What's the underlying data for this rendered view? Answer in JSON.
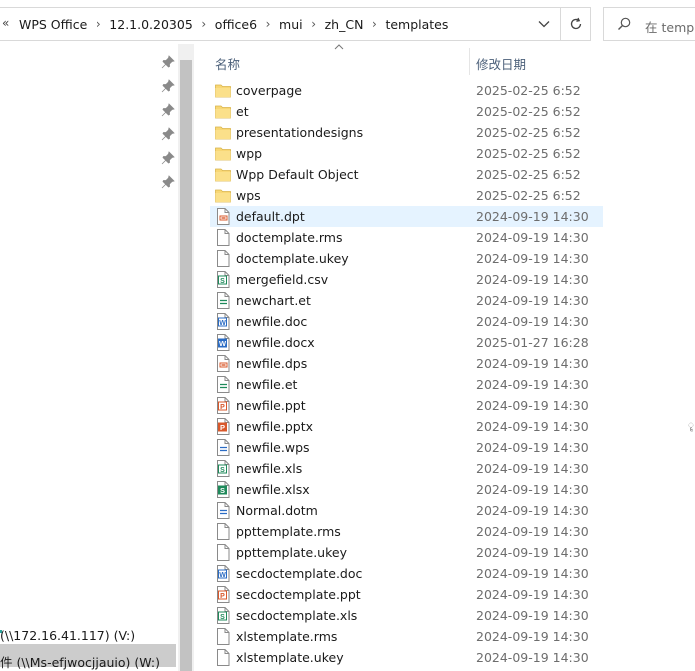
{
  "breadcrumb": {
    "overflow": "«",
    "items": [
      "WPS Office",
      "12.1.0.20305",
      "office6",
      "mui",
      "zh_CN",
      "templates"
    ]
  },
  "search": {
    "placeholder": "在 templa"
  },
  "columns": {
    "name": "名称",
    "date_modified": "修改日期"
  },
  "nav": {
    "drives": [
      "(\\\\172.16.41.117) (V:)",
      "件 (\\\\Ms-efjwocjjauio) (W:)"
    ]
  },
  "files": [
    {
      "name": "coverpage",
      "date": "2025-02-25 6:52",
      "icon": "folder-icon"
    },
    {
      "name": "et",
      "date": "2025-02-25 6:52",
      "icon": "folder-icon"
    },
    {
      "name": "presentationdesigns",
      "date": "2025-02-25 6:52",
      "icon": "folder-icon"
    },
    {
      "name": "wpp",
      "date": "2025-02-25 6:52",
      "icon": "folder-icon"
    },
    {
      "name": "Wpp Default Object",
      "date": "2025-02-25 6:52",
      "icon": "folder-icon"
    },
    {
      "name": "wps",
      "date": "2025-02-25 6:52",
      "icon": "folder-icon"
    },
    {
      "name": "default.dpt",
      "date": "2024-09-19 14:30",
      "icon": "dpt-file-icon",
      "selected": true
    },
    {
      "name": "doctemplate.rms",
      "date": "2024-09-19 14:30",
      "icon": "blank-file-icon"
    },
    {
      "name": "doctemplate.ukey",
      "date": "2024-09-19 14:30",
      "icon": "blank-file-icon"
    },
    {
      "name": "mergefield.csv",
      "date": "2024-09-19 14:30",
      "icon": "spreadsheet-s-file-icon"
    },
    {
      "name": "newchart.et",
      "date": "2024-09-19 14:30",
      "icon": "et-file-icon"
    },
    {
      "name": "newfile.doc",
      "date": "2024-09-19 14:30",
      "icon": "word-w-outline-icon"
    },
    {
      "name": "newfile.docx",
      "date": "2025-01-27 16:28",
      "icon": "word-w-solid-icon"
    },
    {
      "name": "newfile.dps",
      "date": "2024-09-19 14:30",
      "icon": "dps-file-icon"
    },
    {
      "name": "newfile.et",
      "date": "2024-09-19 14:30",
      "icon": "et-file-icon"
    },
    {
      "name": "newfile.ppt",
      "date": "2024-09-19 14:30",
      "icon": "ppt-p-outline-icon"
    },
    {
      "name": "newfile.pptx",
      "date": "2024-09-19 14:30",
      "icon": "ppt-p-solid-icon"
    },
    {
      "name": "newfile.wps",
      "date": "2024-09-19 14:30",
      "icon": "wps-file-icon"
    },
    {
      "name": "newfile.xls",
      "date": "2024-09-19 14:30",
      "icon": "xls-s-outline-icon"
    },
    {
      "name": "newfile.xlsx",
      "date": "2024-09-19 14:30",
      "icon": "xls-s-solid-icon"
    },
    {
      "name": "Normal.dotm",
      "date": "2024-09-19 14:30",
      "icon": "wps-file-icon"
    },
    {
      "name": "ppttemplate.rms",
      "date": "2024-09-19 14:30",
      "icon": "blank-file-icon"
    },
    {
      "name": "ppttemplate.ukey",
      "date": "2024-09-19 14:30",
      "icon": "blank-file-icon"
    },
    {
      "name": "secdoctemplate.doc",
      "date": "2024-09-19 14:30",
      "icon": "word-w-outline-icon"
    },
    {
      "name": "secdoctemplate.ppt",
      "date": "2024-09-19 14:30",
      "icon": "ppt-p-outline-icon"
    },
    {
      "name": "secdoctemplate.xls",
      "date": "2024-09-19 14:30",
      "icon": "xls-s-outline-icon"
    },
    {
      "name": "xlstemplate.rms",
      "date": "2024-09-19 14:30",
      "icon": "blank-file-icon"
    },
    {
      "name": "xlstemplate.ukey",
      "date": "2024-09-19 14:30",
      "icon": "blank-file-icon"
    }
  ],
  "colors": {
    "selection": "#e5f3ff",
    "folder": "#f8d775",
    "word": "#2b6cc4",
    "excel": "#1f8a5b",
    "ppt": "#d9582b",
    "header_text": "#4c607a"
  }
}
